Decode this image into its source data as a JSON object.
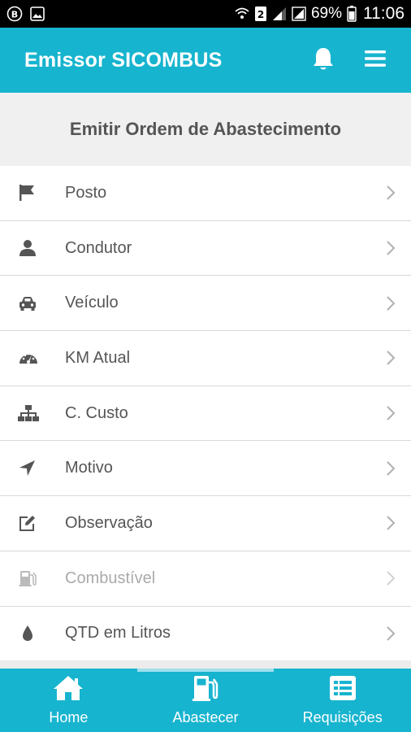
{
  "status_bar": {
    "battery_percent": "69%",
    "time": "11:06",
    "icons": [
      "bluetooth-icon",
      "image-icon",
      "wifi-icon",
      "sim-2-icon",
      "signal-icon",
      "signal-icon",
      "battery-icon"
    ]
  },
  "app_bar": {
    "title": "Emissor SICOMBUS",
    "icons": [
      "bell-icon",
      "menu-icon"
    ],
    "color": "#17b4cf"
  },
  "section": {
    "title": "Emitir Ordem de Abastecimento"
  },
  "list": {
    "items": [
      {
        "label": "Posto",
        "icon": "flag-icon"
      },
      {
        "label": "Condutor",
        "icon": "user-icon"
      },
      {
        "label": "Veículo",
        "icon": "car-icon"
      },
      {
        "label": "KM Atual",
        "icon": "tachometer-icon"
      },
      {
        "label": "C. Custo",
        "icon": "sitemap-icon"
      },
      {
        "label": "Motivo",
        "icon": "location-arrow-icon"
      },
      {
        "label": "Observação",
        "icon": "edit-icon"
      },
      {
        "label": "Combustível",
        "icon": "gas-pump-icon",
        "disabled": true
      },
      {
        "label": "QTD em Litros",
        "icon": "droplet-icon"
      }
    ]
  },
  "bottom_nav": {
    "items": [
      {
        "label": "Home",
        "icon": "home-icon"
      },
      {
        "label": "Abastecer",
        "icon": "gas-pump-icon",
        "active": true
      },
      {
        "label": "Requisições",
        "icon": "list-icon"
      }
    ]
  }
}
